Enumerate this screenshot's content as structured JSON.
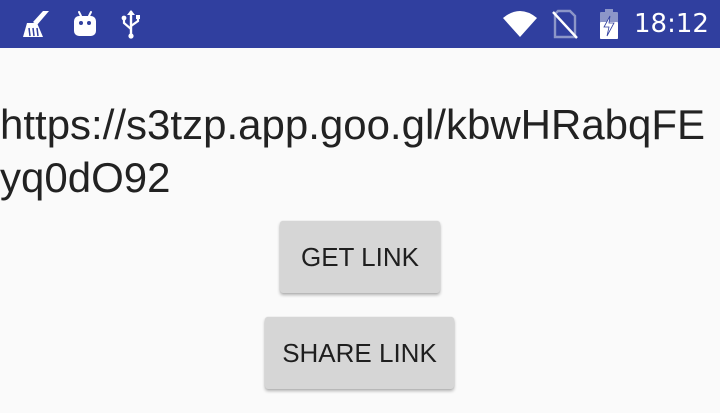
{
  "status_bar": {
    "time": "18:12",
    "color": "#303f9f",
    "icons": [
      "cleaner-icon",
      "android-debug-icon",
      "usb-icon",
      "wifi-icon",
      "no-sim-icon",
      "battery-charging-icon"
    ]
  },
  "main": {
    "link_text": "https://s3tzp.app.goo.gl/kbwHRabqFEyq0dO92",
    "get_link_label": "GET LINK",
    "share_link_label": "SHARE LINK",
    "background": "#fafafa",
    "button_color": "#d6d6d6"
  }
}
